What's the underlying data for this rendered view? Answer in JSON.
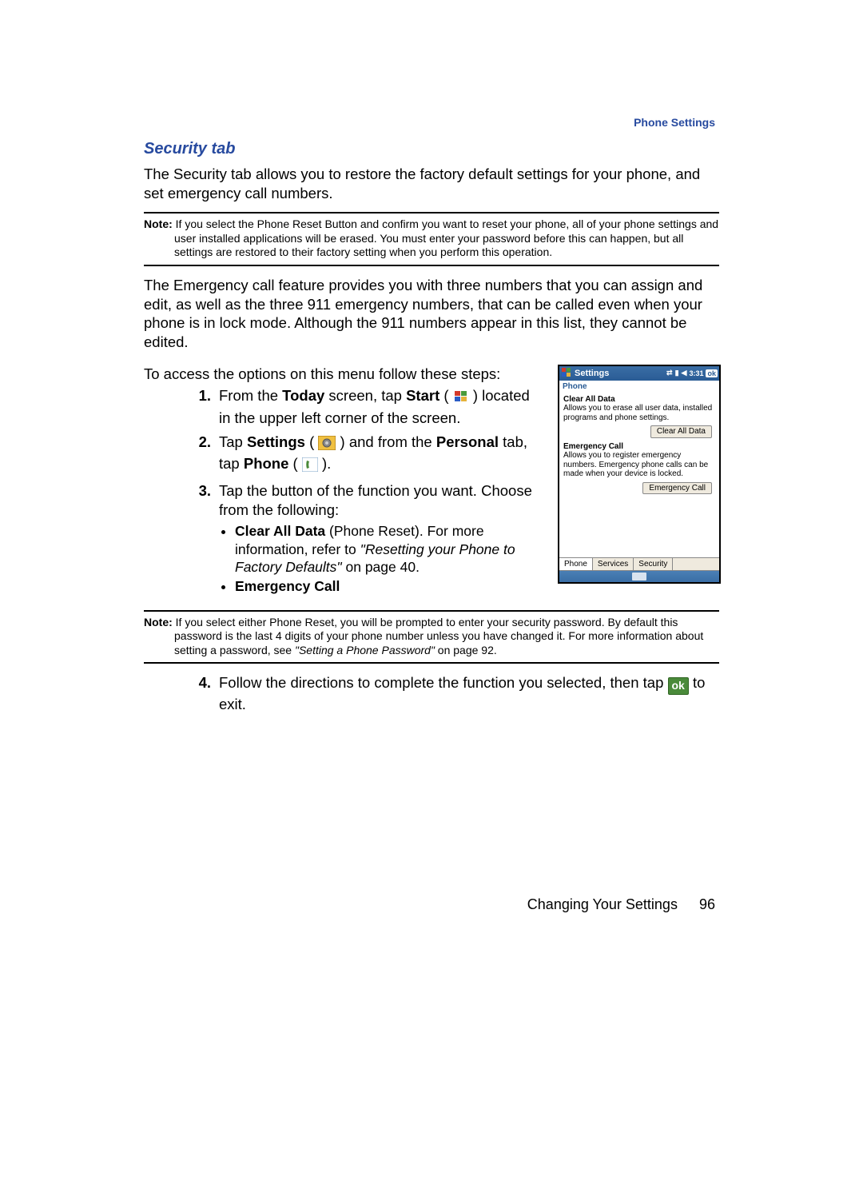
{
  "header": {
    "section": "Phone Settings"
  },
  "title": "Security tab",
  "intro": "The Security tab allows you to restore the factory default settings for your phone, and set emergency call numbers.",
  "note1_label": "Note:",
  "note1": "If you select the Phone Reset Button and confirm you want to reset your phone, all of your phone settings and user installed applications will be erased. You must enter your password before this can happen, but all settings are restored to their factory setting when you perform this operation.",
  "para2": "The Emergency call feature provides you with three numbers that you can assign and edit, as well as the three 911 emergency numbers, that can be called even when your phone is in lock mode. Although the 911 numbers appear in this list, they cannot be edited.",
  "para3": "To access the options on this menu follow these steps:",
  "steps": {
    "s1a": "From the ",
    "s1b_bold": "Today",
    "s1c": " screen, tap ",
    "s1d_bold": "Start",
    "s1e": " ( ",
    "s1f": " ) located in the upper left corner of the screen.",
    "s2a": "Tap ",
    "s2b_bold": "Settings",
    "s2c": " ( ",
    "s2d": " ) and from the ",
    "s2e_bold": "Personal",
    "s2f": " tab, tap ",
    "s2g_bold": "Phone",
    "s2h": " ( ",
    "s2i": " ).",
    "s3": "Tap the button of the function you want. Choose from the following:",
    "s4a": "Follow the directions to complete the function you selected, then tap ",
    "s4b": " to exit."
  },
  "sub": {
    "a_bold": "Clear All Data",
    "a_rest": " (Phone Reset). For more information, refer to ",
    "a_ref": "\"Resetting your Phone to Factory Defaults\"",
    "a_page": "  on page 40.",
    "b_bold": "Emergency Call"
  },
  "note2_label": "Note:",
  "note2a": "If you select either Phone Reset, you will be prompted to enter your security password. By default this password is the last 4 digits of your phone number unless you have changed it. For more information about setting a password, see ",
  "note2_ref": "\"Setting a Phone Password\"",
  "note2b": "  on page 92.",
  "ok_label": "ok",
  "footer": {
    "chapter": "Changing Your Settings",
    "page": "96"
  },
  "device": {
    "title": "Settings",
    "time": "3:31",
    "ok": "ok",
    "sub": "Phone",
    "cad_title": "Clear All Data",
    "cad_desc": "Allows you to erase all user data, installed programs and phone settings.",
    "cad_btn": "Clear All Data",
    "ec_title": "Emergency Call",
    "ec_desc": "Allows you to register emergency numbers. Emergency phone calls can be made when your device is locked.",
    "ec_btn": "Emergency Call",
    "tabs": [
      "Phone",
      "Services",
      "Security"
    ]
  }
}
